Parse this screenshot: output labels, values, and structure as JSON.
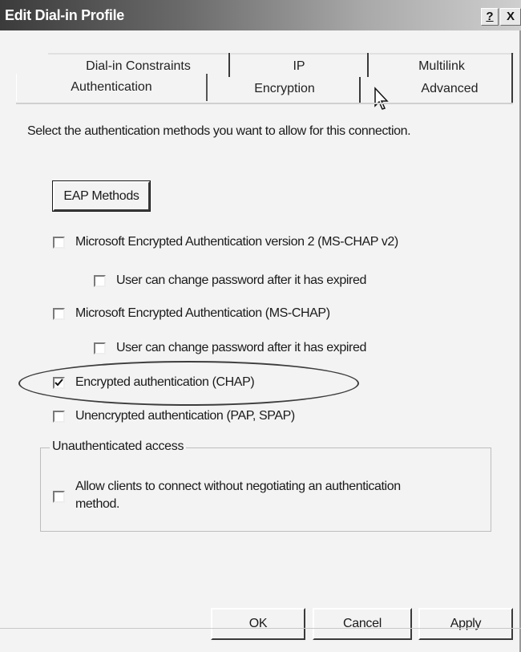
{
  "window": {
    "title": "Edit Dial-in Profile",
    "help_label": "?",
    "close_label": "X"
  },
  "tabs": {
    "back": [
      {
        "label": "Dial-in Constraints"
      },
      {
        "label": "IP"
      },
      {
        "label": "Multilink"
      }
    ],
    "front": [
      {
        "label": "Authentication",
        "active": true
      },
      {
        "label": "Encryption"
      },
      {
        "label": "Advanced"
      }
    ]
  },
  "panel": {
    "instruction": "Select the authentication methods you want to allow for this connection.",
    "eap_button": "EAP Methods",
    "options": [
      {
        "label": "Microsoft Encrypted Authentication version 2 (MS-CHAP v2)",
        "checked": false
      },
      {
        "label": "User can change password after it has expired",
        "checked": false
      },
      {
        "label": "Microsoft Encrypted Authentication (MS-CHAP)",
        "checked": false
      },
      {
        "label": "User can change password after it has expired",
        "checked": false
      },
      {
        "label": "Encrypted authentication (CHAP)",
        "checked": true
      },
      {
        "label": "Unencrypted authentication (PAP, SPAP)",
        "checked": false
      }
    ],
    "unauth_group": {
      "label": "Unauthenticated access",
      "option_line1": "Allow clients to connect without negotiating an authentication",
      "option_line2": "method.",
      "checked": false
    }
  },
  "footer": {
    "ok": "OK",
    "cancel": "Cancel",
    "apply": "Apply"
  }
}
